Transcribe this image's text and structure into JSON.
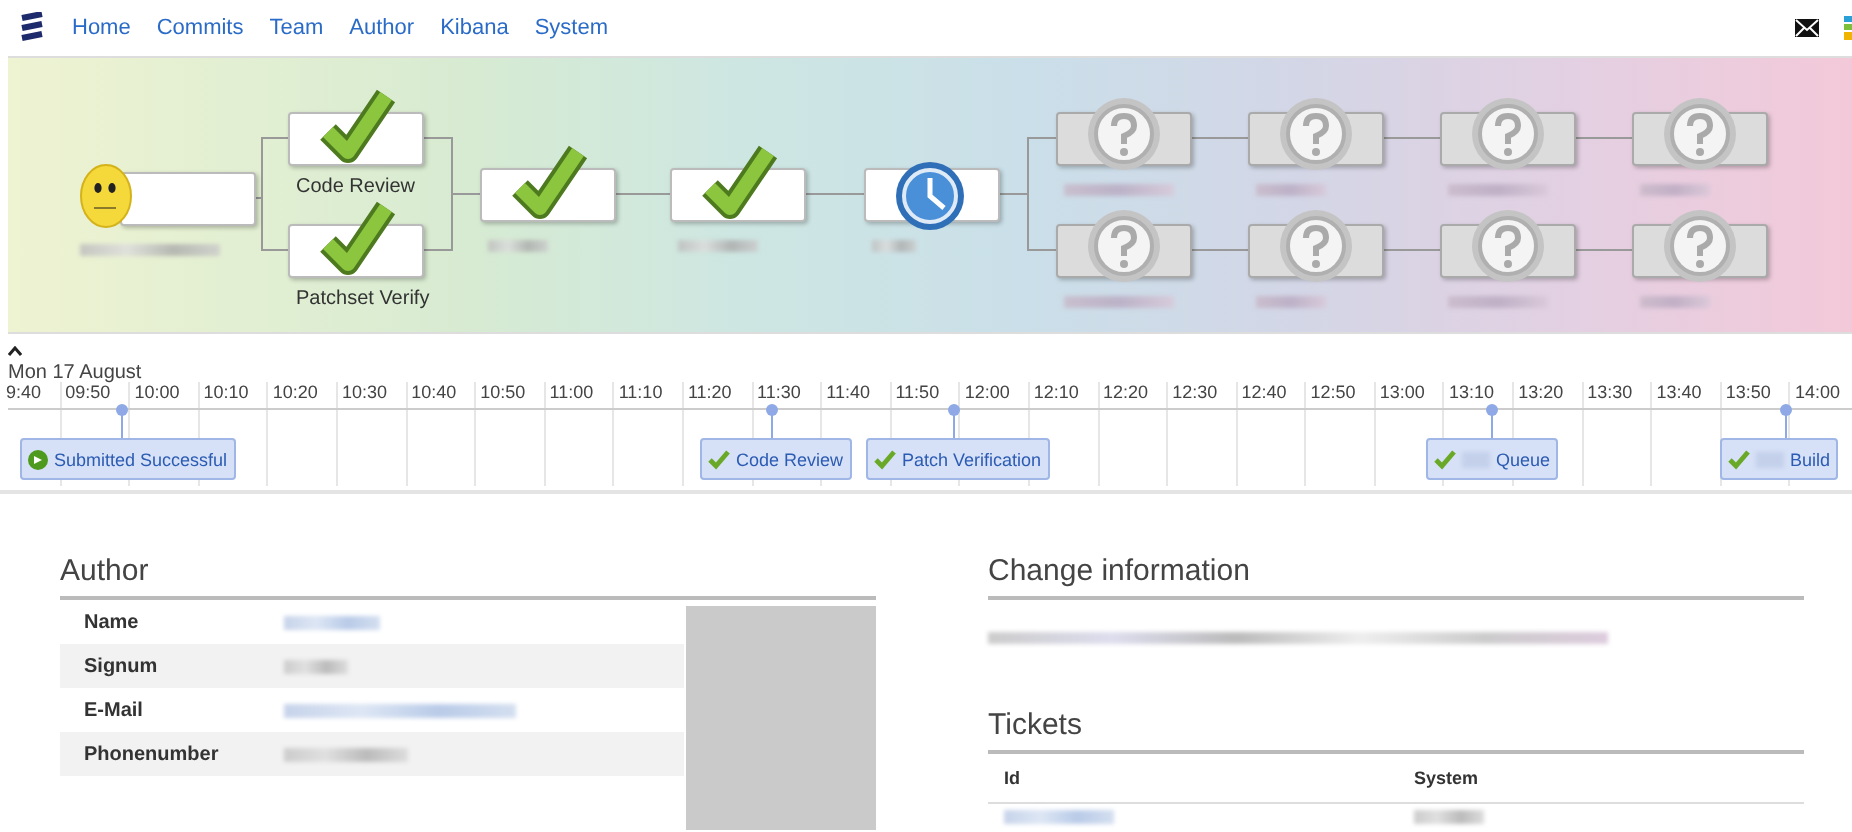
{
  "nav": {
    "links": [
      "Home",
      "Commits",
      "Team",
      "Author",
      "Kibana",
      "System"
    ]
  },
  "pipeline": {
    "nodes": [
      {
        "kind": "neutral"
      },
      {
        "kind": "passed",
        "label": "Code Review"
      },
      {
        "kind": "passed",
        "label": "Patchset Verify"
      },
      {
        "kind": "passed"
      },
      {
        "kind": "passed"
      },
      {
        "kind": "running"
      },
      {
        "kind": "unknown"
      },
      {
        "kind": "unknown"
      },
      {
        "kind": "unknown"
      },
      {
        "kind": "unknown"
      },
      {
        "kind": "unknown"
      },
      {
        "kind": "unknown"
      },
      {
        "kind": "unknown"
      },
      {
        "kind": "unknown"
      }
    ]
  },
  "timeline": {
    "date": "Mon 17 August",
    "ticks": [
      "9:40",
      "09:50",
      "10:00",
      "10:10",
      "10:20",
      "10:30",
      "10:40",
      "10:50",
      "11:00",
      "11:10",
      "11:20",
      "11:30",
      "11:40",
      "11:50",
      "12:00",
      "12:10",
      "12:20",
      "12:30",
      "12:40",
      "12:50",
      "13:00",
      "13:10",
      "13:20",
      "13:30",
      "13:40",
      "13:50",
      "14:00"
    ],
    "events": [
      {
        "label": "Submitted Successful",
        "kind": "started"
      },
      {
        "label": "Code Review",
        "kind": "passed"
      },
      {
        "label": "Patch Verification",
        "kind": "passed"
      },
      {
        "label": "Queue",
        "kind": "passed-redacted"
      },
      {
        "label": "Build",
        "kind": "passed-redacted"
      }
    ]
  },
  "author": {
    "title": "Author",
    "rows": [
      {
        "label": "Name"
      },
      {
        "label": "Signum"
      },
      {
        "label": "E-Mail"
      },
      {
        "label": "Phonenumber"
      }
    ]
  },
  "change": {
    "title": "Change information"
  },
  "tickets": {
    "title": "Tickets",
    "columns": [
      "Id",
      "System"
    ]
  }
}
